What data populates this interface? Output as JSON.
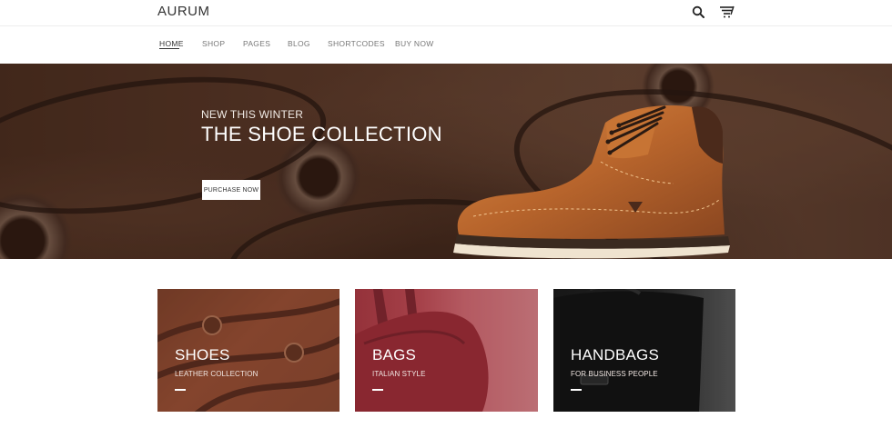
{
  "header": {
    "logo": "AURUM",
    "icons": {
      "search": "search-icon",
      "cart": "cart-icon"
    }
  },
  "nav": {
    "items": [
      {
        "label": "HOME",
        "active": true
      },
      {
        "label": "SHOP",
        "active": false
      },
      {
        "label": "PAGES",
        "active": false
      },
      {
        "label": "BLOG",
        "active": false
      },
      {
        "label": "SHORTCODES",
        "active": false
      },
      {
        "label": "BUY NOW",
        "active": false
      }
    ]
  },
  "hero": {
    "subtitle": "NEW THIS WINTER",
    "title": "THE SHOE COLLECTION",
    "button_label": "PURCHASE NOW"
  },
  "categories": [
    {
      "title": "SHOES",
      "subtitle": "LEATHER COLLECTION",
      "color": "#7b4430"
    },
    {
      "title": "BAGS",
      "subtitle": "ITALIAN STYLE",
      "color": "#a4434a"
    },
    {
      "title": "HANDBAGS",
      "subtitle": "FOR BUSINESS PEOPLE",
      "color": "#272727"
    }
  ],
  "colors": {
    "accent": "#333333",
    "nav_text": "#777777",
    "hero_bg": "#5c3b2b"
  }
}
